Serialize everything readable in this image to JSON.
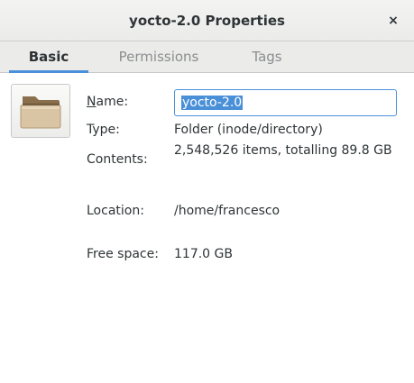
{
  "window": {
    "title": "yocto-2.0 Properties",
    "close_glyph": "×"
  },
  "tabs": [
    {
      "label": "Basic",
      "active": true
    },
    {
      "label": "Permissions",
      "active": false
    },
    {
      "label": "Tags",
      "active": false
    }
  ],
  "icon": {
    "name": "folder-icon",
    "color": "#c9b08a"
  },
  "fields": {
    "name_label_mnemonic": "N",
    "name_label_rest": "ame:",
    "name_value": "yocto-2.0",
    "type_label": "Type:",
    "type_value": "Folder (inode/directory)",
    "contents_label": "Contents:",
    "contents_value": "2,548,526 items, totalling 89.8 GB",
    "location_label": "Location:",
    "location_value": "/home/francesco",
    "free_space_label": "Free space:",
    "free_space_value": "117.0 GB"
  },
  "colors": {
    "accent": "#4a90d9",
    "text": "#2e3436",
    "inactive_tab": "#8b8e8f"
  }
}
